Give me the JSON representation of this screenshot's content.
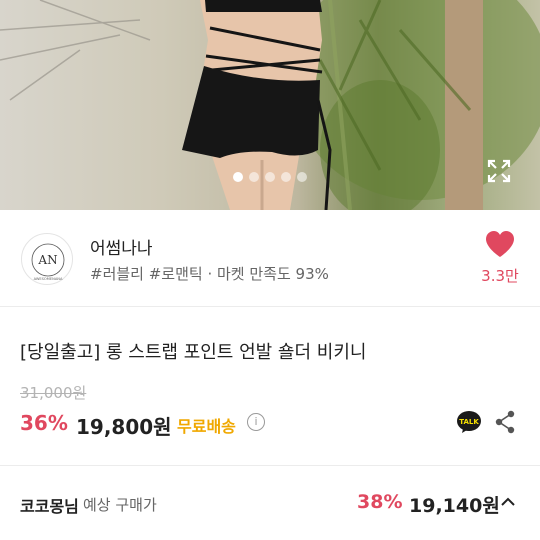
{
  "gallery": {
    "dot_count": 5,
    "active_dot": 1,
    "expand_icon": "expand-icon"
  },
  "shop": {
    "name": "어썸나나",
    "tags": "#러블리 #로맨틱 · 마켓 만족도 93%",
    "logo_initials": "AN",
    "logo_text": "AWESOMENANA",
    "like_icon": "heart-icon",
    "like_count": "3.3만"
  },
  "product": {
    "title": "[당일출고] 롱 스트랩 포인트 언발 숄더 비키니",
    "original_price": "31,000원",
    "discount": "36%",
    "price": "19,800원",
    "shipping": "무료배송",
    "info_icon": "info-icon",
    "talk_icon": "kakao-talk-icon",
    "share_icon": "share-icon"
  },
  "member_price": {
    "name": "코코몽님",
    "label": "예상 구매가",
    "discount": "38%",
    "price": "19,140원",
    "toggle_icon": "chevron-up-icon"
  },
  "colors": {
    "accent_red": "#e0485f",
    "free_shipping": "#f0a800",
    "muted": "#b3b3b3"
  }
}
